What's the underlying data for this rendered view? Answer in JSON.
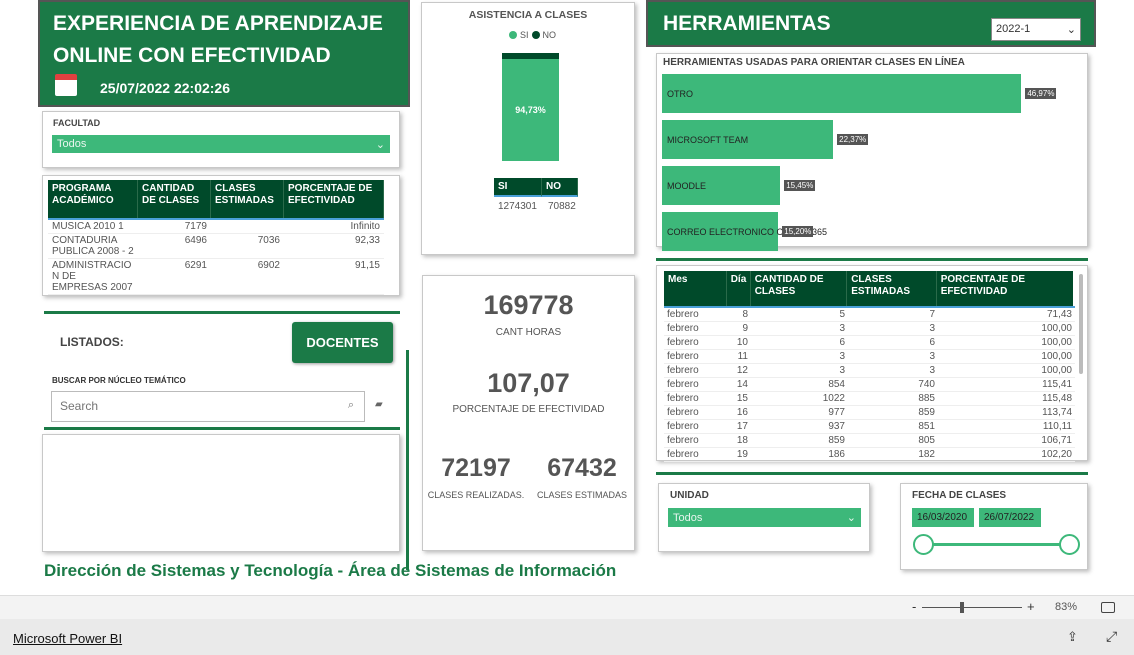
{
  "header": {
    "title_line1": "EXPERIENCIA DE APRENDIZAJE",
    "title_line2": "ONLINE CON EFECTIVIDAD",
    "datetime": "25/07/2022 22:02:26",
    "icon": "calendar-icon"
  },
  "facultad": {
    "label": "FACULTAD",
    "value": "Todos"
  },
  "programs": {
    "columns": [
      "PROGRAMA ACADÉMICO",
      "CANTIDAD DE CLASES",
      "CLASES ESTIMADAS",
      "PORCENTAJE DE EFECTIVIDAD"
    ],
    "rows": [
      [
        "MUSICA 2010 1",
        "7179",
        "",
        "Infinito"
      ],
      [
        "CONTADURIA PUBLICA 2008 - 2",
        "6496",
        "7036",
        "92,33"
      ],
      [
        "ADMINISTRACIO N DE EMPRESAS 2007",
        "6291",
        "6902",
        "91,15"
      ]
    ]
  },
  "listados": {
    "label": "LISTADOS:",
    "docentes_button": "DOCENTES",
    "search_label": "BUSCAR POR NÚCLEO TEMÁTICO",
    "search_placeholder": "Search"
  },
  "footer_text": "Dirección de Sistemas y Tecnología - Área de Sistemas de Información",
  "asistencia": {
    "title": "ASISTENCIA A CLASES",
    "legend": [
      "SI",
      "NO"
    ],
    "si_percent": 94.73,
    "si_label": "94,73%",
    "table_headers": [
      "SI",
      "NO"
    ],
    "values": [
      "1274301",
      "70882"
    ]
  },
  "kpis": [
    {
      "value": "169778",
      "label": "CANT HORAS"
    },
    {
      "value": "107,07",
      "label": "PORCENTAJE DE EFECTIVIDAD"
    },
    {
      "value": "72197",
      "label": "CLASES REALIZADAS."
    },
    {
      "value": "67432",
      "label": "CLASES ESTIMADAS"
    }
  ],
  "herramientas": {
    "title": "HERRAMIENTAS",
    "period": "2022-1",
    "chart_title": "HERRAMIENTAS USADAS PARA ORIENTAR CLASES EN LÍNEA",
    "items": [
      {
        "name": "OTRO",
        "value": 46.97,
        "label": "46,97%"
      },
      {
        "name": "MICROSOFT TEAM",
        "value": 22.37,
        "label": "22,37%"
      },
      {
        "name": "MOODLE",
        "value": 15.45,
        "label": "15,45%"
      },
      {
        "name": "CORREO ELECTRONICO OFFICE 365",
        "value": 15.2,
        "label": "15,20%"
      }
    ]
  },
  "daily": {
    "columns": [
      "Mes",
      "Día",
      "CANTIDAD DE CLASES",
      "CLASES ESTIMADAS",
      "PORCENTAJE DE EFECTIVIDAD"
    ],
    "rows": [
      [
        "febrero",
        "8",
        "5",
        "7",
        "71,43"
      ],
      [
        "febrero",
        "9",
        "3",
        "3",
        "100,00"
      ],
      [
        "febrero",
        "10",
        "6",
        "6",
        "100,00"
      ],
      [
        "febrero",
        "11",
        "3",
        "3",
        "100,00"
      ],
      [
        "febrero",
        "12",
        "3",
        "3",
        "100,00"
      ],
      [
        "febrero",
        "14",
        "854",
        "740",
        "115,41"
      ],
      [
        "febrero",
        "15",
        "1022",
        "885",
        "115,48"
      ],
      [
        "febrero",
        "16",
        "977",
        "859",
        "113,74"
      ],
      [
        "febrero",
        "17",
        "937",
        "851",
        "110,11"
      ],
      [
        "febrero",
        "18",
        "859",
        "805",
        "106,71"
      ],
      [
        "febrero",
        "19",
        "186",
        "182",
        "102,20"
      ]
    ]
  },
  "unidad": {
    "label": "UNIDAD",
    "value": "Todos"
  },
  "fecha": {
    "label": "FECHA DE CLASES",
    "start": "16/03/2020",
    "end": "26/07/2022"
  },
  "bottom": {
    "zoom": "83%",
    "minus": "-",
    "plus": "+",
    "link": "Microsoft Power BI"
  },
  "colors": {
    "banner": "#1b7a47",
    "table_header": "#004a2a",
    "bar": "#3db87a"
  }
}
